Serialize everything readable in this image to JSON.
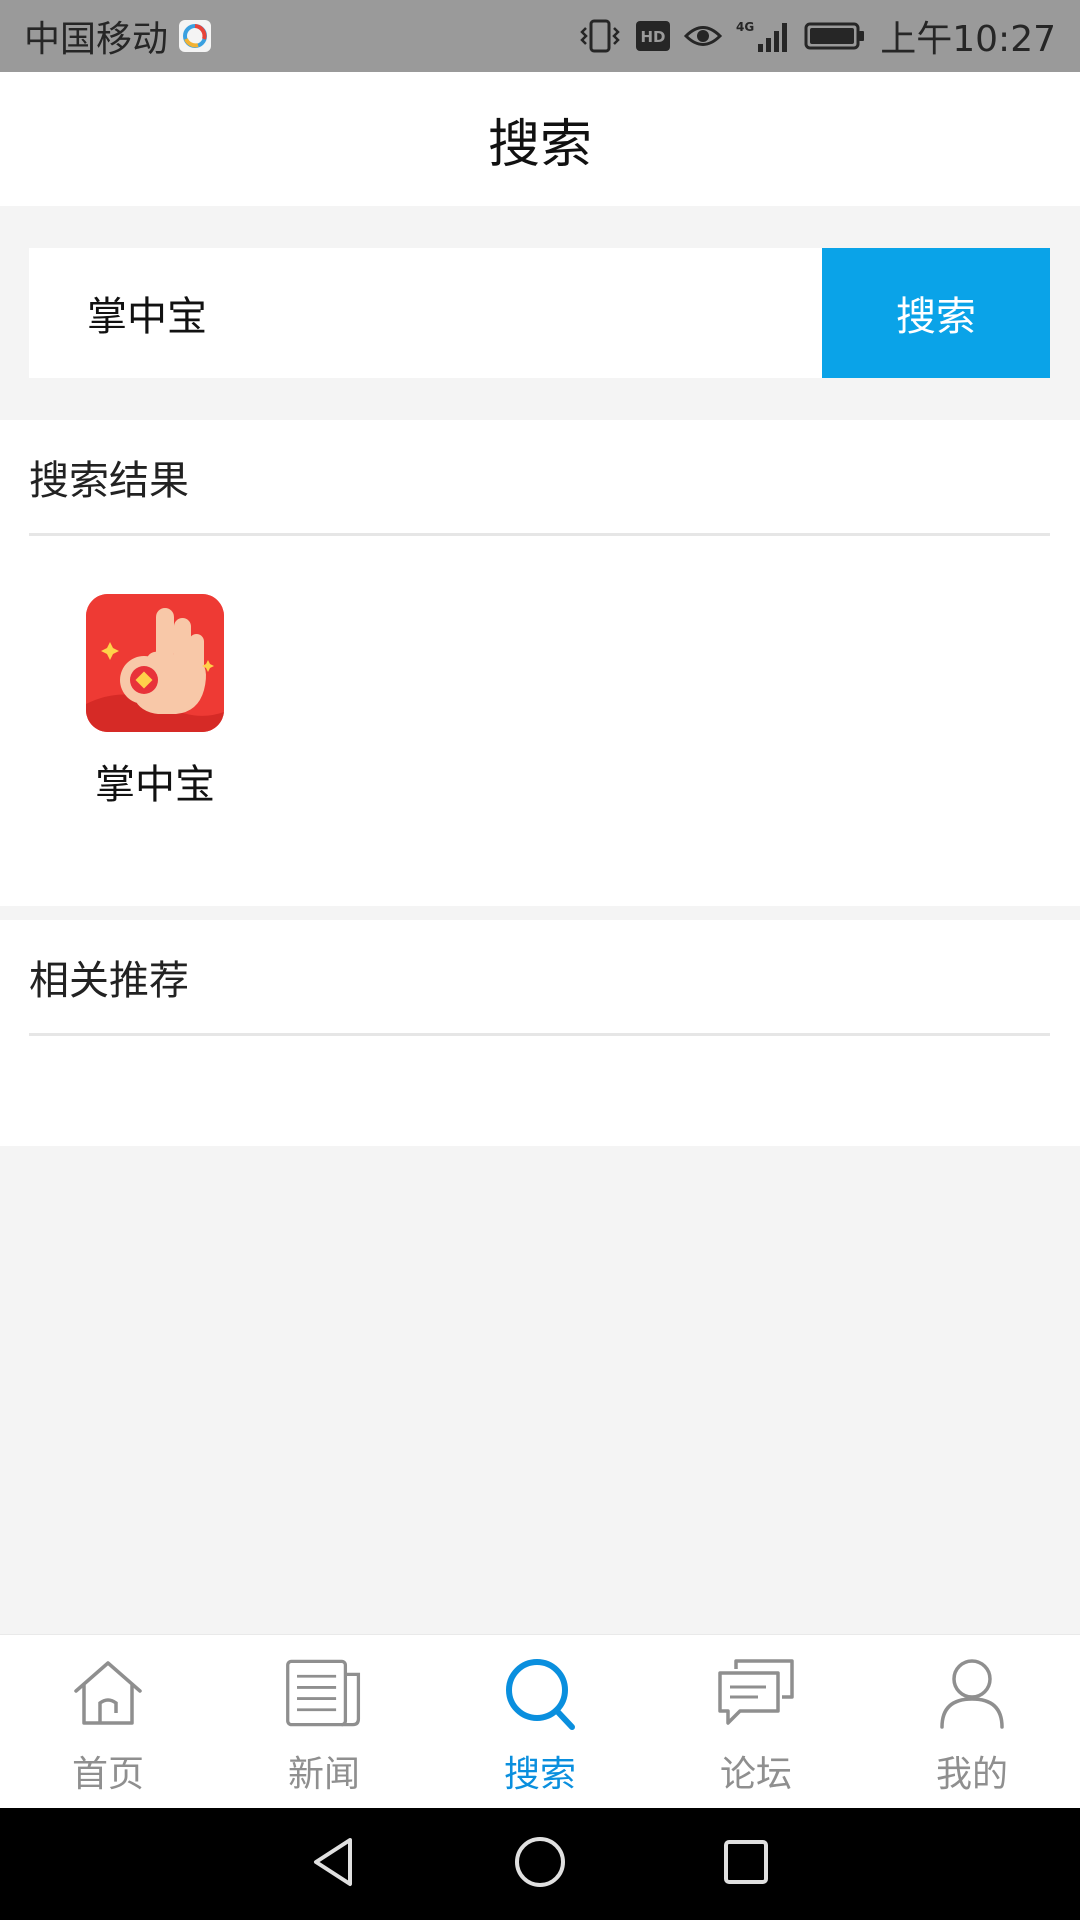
{
  "status_bar": {
    "carrier": "中国移动",
    "network": "4G",
    "time": "上午10:27",
    "icons": [
      "app-icon",
      "vibrate-icon",
      "hd-icon",
      "eye-icon",
      "signal-icon",
      "battery-icon"
    ]
  },
  "header": {
    "title": "搜索"
  },
  "search": {
    "value": "掌中宝",
    "button_label": "搜索"
  },
  "results": {
    "title": "搜索结果",
    "items": [
      {
        "name": "掌中宝",
        "icon": "ok-hand-coin-icon"
      }
    ]
  },
  "recommend": {
    "title": "相关推荐"
  },
  "bottom_nav": {
    "items": [
      {
        "label": "首页",
        "icon": "home-icon",
        "active": false
      },
      {
        "label": "新闻",
        "icon": "news-icon",
        "active": false
      },
      {
        "label": "搜索",
        "icon": "search-icon",
        "active": true
      },
      {
        "label": "论坛",
        "icon": "forum-icon",
        "active": false
      },
      {
        "label": "我的",
        "icon": "user-icon",
        "active": false
      }
    ]
  },
  "colors": {
    "accent": "#0aa3e8",
    "active_nav": "#0a8fde",
    "inactive_nav": "#8f8f8f",
    "status_bar": "#9a9a9a"
  }
}
